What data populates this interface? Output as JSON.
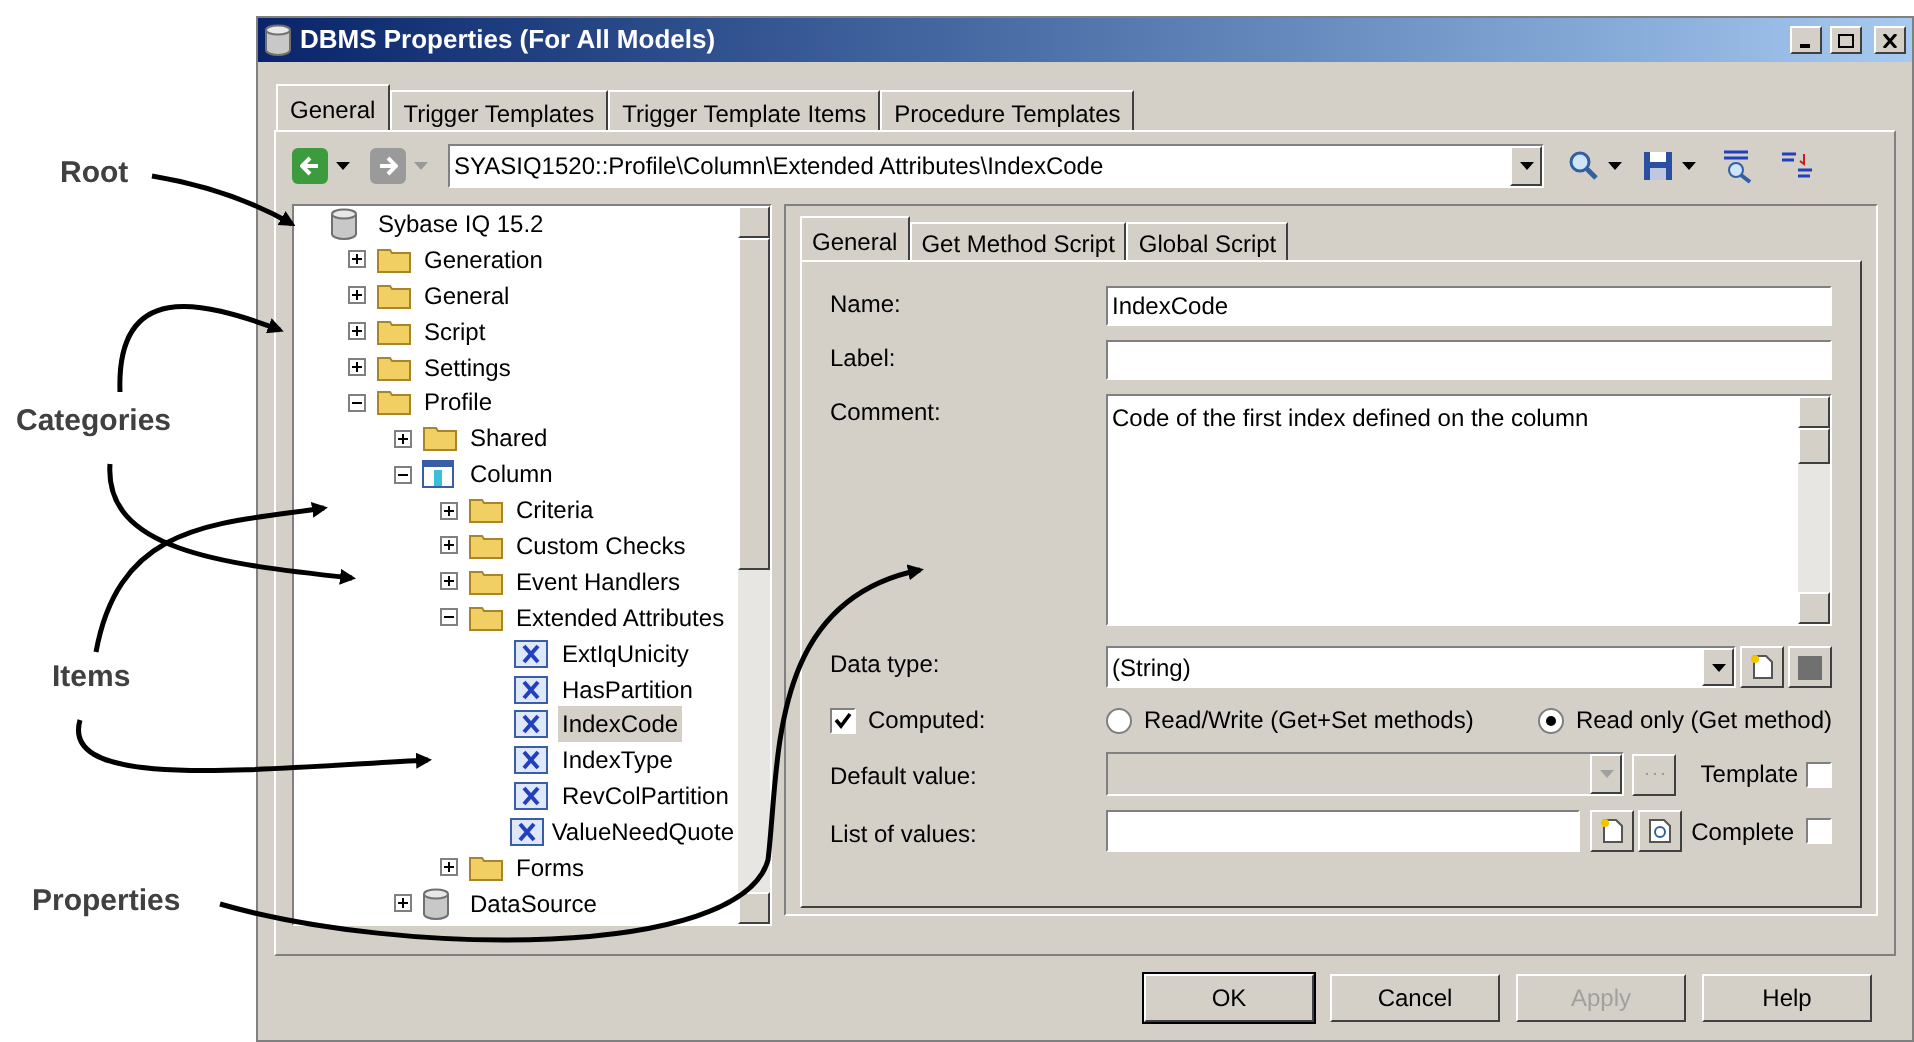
{
  "annotations": [
    {
      "label": "Root"
    },
    {
      "label": "Categories"
    },
    {
      "label": "Items"
    },
    {
      "label": "Properties"
    }
  ],
  "window": {
    "title": "DBMS Properties (For All Models)"
  },
  "tabs": [
    {
      "label": "General",
      "selected": true
    },
    {
      "label": "Trigger Templates",
      "selected": false
    },
    {
      "label": "Trigger Template Items",
      "selected": false
    },
    {
      "label": "Procedure Templates",
      "selected": false
    }
  ],
  "toolbar": {
    "path": "SYASIQ1520::Profile\\Column\\Extended Attributes\\IndexCode"
  },
  "tree": {
    "label": "Sybase IQ 15.2",
    "kind": "database",
    "selected": false,
    "children": [
      {
        "label": "Generation",
        "kind": "folder",
        "expanded": false,
        "selected": false
      },
      {
        "label": "General",
        "kind": "folder",
        "expanded": false,
        "selected": false
      },
      {
        "label": "Script",
        "kind": "folder",
        "expanded": false,
        "selected": false
      },
      {
        "label": "Settings",
        "kind": "folder",
        "expanded": false,
        "selected": false
      },
      {
        "label": "Profile",
        "kind": "folder",
        "expanded": true,
        "selected": false,
        "children": [
          {
            "label": "Shared",
            "kind": "folder",
            "expanded": false,
            "selected": false
          },
          {
            "label": "Column",
            "kind": "table",
            "expanded": true,
            "selected": false,
            "children": [
              {
                "label": "Criteria",
                "kind": "folder",
                "expanded": false,
                "selected": false
              },
              {
                "label": "Custom Checks",
                "kind": "folder",
                "expanded": false,
                "selected": false
              },
              {
                "label": "Event Handlers",
                "kind": "folder",
                "expanded": false,
                "selected": false
              },
              {
                "label": "Extended Attributes",
                "kind": "folder",
                "expanded": true,
                "selected": false,
                "children": [
                  {
                    "label": "ExtIqUnicity",
                    "kind": "attribute",
                    "selected": false
                  },
                  {
                    "label": "HasPartition",
                    "kind": "attribute",
                    "selected": false
                  },
                  {
                    "label": "IndexCode",
                    "kind": "attribute",
                    "selected": true
                  },
                  {
                    "label": "IndexType",
                    "kind": "attribute",
                    "selected": false
                  },
                  {
                    "label": "RevColPartition",
                    "kind": "attribute",
                    "selected": false
                  },
                  {
                    "label": "ValueNeedQuote",
                    "kind": "attribute",
                    "selected": false
                  }
                ]
              },
              {
                "label": "Forms",
                "kind": "folder",
                "expanded": false,
                "selected": false
              }
            ]
          },
          {
            "label": "DataSource",
            "kind": "database",
            "expanded": false,
            "selected": false
          }
        ]
      }
    ]
  },
  "detail": {
    "tabs": [
      {
        "label": "General",
        "selected": true
      },
      {
        "label": "Get Method Script",
        "selected": false
      },
      {
        "label": "Global Script",
        "selected": false
      }
    ],
    "name": {
      "label": "Name:",
      "value": "IndexCode"
    },
    "label": {
      "label": "Label:"
    },
    "comment": {
      "label": "Comment:",
      "value": "Code of the first index defined on the column"
    },
    "data_type": {
      "label": "Data type:",
      "value": "(String)"
    },
    "computed": {
      "label": "Computed:",
      "checked": true
    },
    "access": [
      {
        "label": "Read/Write (Get+Set methods)",
        "selected": false
      },
      {
        "label": "Read only (Get method)",
        "selected": true
      }
    ],
    "default_value": {
      "label": "Default value:",
      "disabled": true
    },
    "template": {
      "label": "Template",
      "checked": false
    },
    "list_of_values": {
      "label": "List of values:"
    },
    "complete": {
      "label": "Complete",
      "checked": false
    }
  },
  "buttons": [
    {
      "label": "OK",
      "disabled": false
    },
    {
      "label": "Cancel",
      "disabled": false
    },
    {
      "label": "Apply",
      "disabled": true
    },
    {
      "label": "Help",
      "disabled": false
    }
  ]
}
